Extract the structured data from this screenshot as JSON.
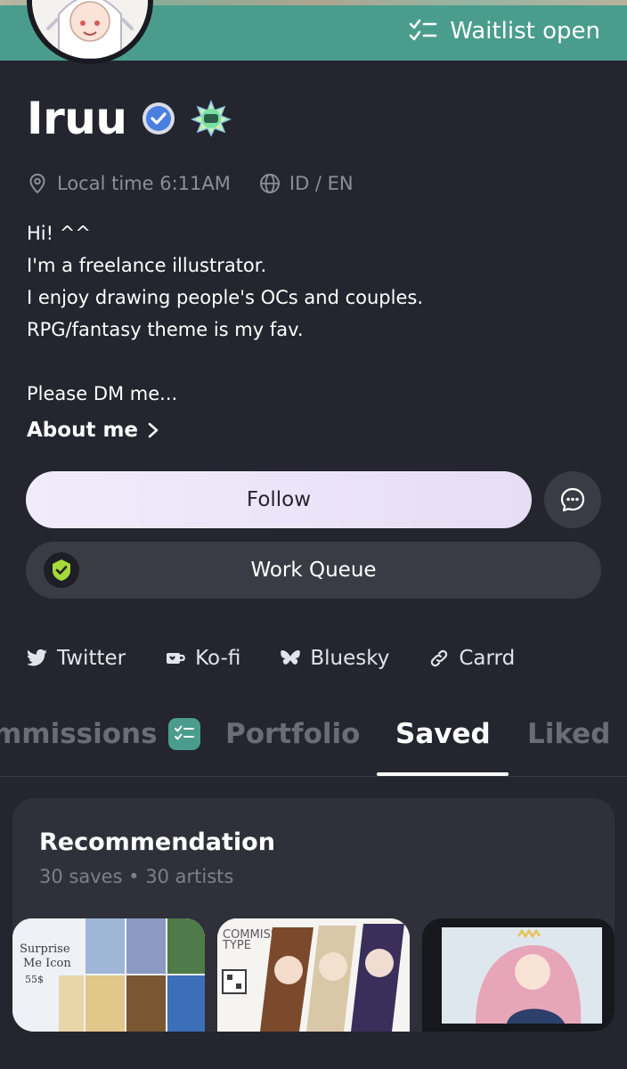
{
  "banner": {
    "waitlist_label": "Waitlist open"
  },
  "profile": {
    "name": "Iruu",
    "local_time": "Local time 6:11AM",
    "languages": "ID / EN",
    "bio_lines": [
      "Hi! ^^",
      "I'm a freelance illustrator.",
      "I enjoy drawing people's OCs and couples.",
      "RPG/fantasy theme is my fav.",
      "",
      "Please DM me..."
    ],
    "about_label": "About me"
  },
  "actions": {
    "follow_label": "Follow",
    "work_queue_label": "Work Queue"
  },
  "socials": [
    {
      "label": "Twitter",
      "icon": "twitter-bird-icon"
    },
    {
      "label": "Ko-fi",
      "icon": "kofi-cup-icon"
    },
    {
      "label": "Bluesky",
      "icon": "butterfly-icon"
    },
    {
      "label": "Carrd",
      "icon": "link-icon"
    }
  ],
  "tabs": [
    {
      "label": "mmissions",
      "active": false
    },
    {
      "label": "Portfolio",
      "active": false
    },
    {
      "label": "Saved",
      "active": true
    },
    {
      "label": "Liked",
      "active": false
    }
  ],
  "collection": {
    "title": "Recommendation",
    "subtitle": "30 saves • 30 artists",
    "thumbs": [
      {
        "text_1": "Surprise",
        "text_2": "Me Icon",
        "text_3": "55$"
      },
      {
        "text_1": "COMMISSION",
        "text_2": "TYPE"
      },
      {}
    ]
  },
  "colors": {
    "background": "#24252e",
    "accent_teal": "#4a9d8c",
    "follow_button": "#f1ecfb",
    "verified_blue": "#4a7fe0",
    "queue_green": "#a6d93a",
    "muted_text": "#8c8e98"
  }
}
